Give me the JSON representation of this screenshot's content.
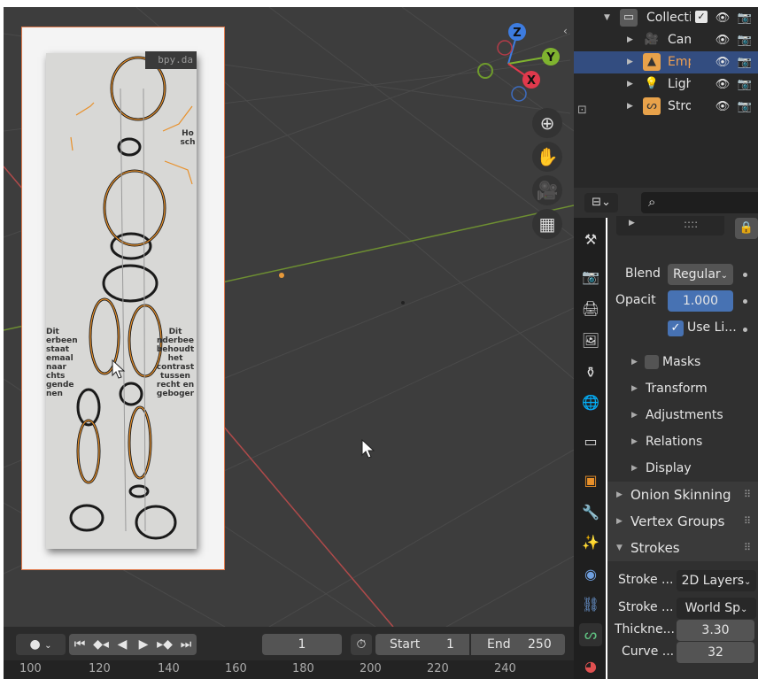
{
  "viewport": {
    "paper_tag": "bpy.da",
    "paper_left_text": [
      "Dit",
      "erbeen",
      "staat",
      "emaal",
      "naar",
      "chts",
      "gende",
      "nen"
    ],
    "paper_right_text": [
      "Dit",
      "nderbee",
      "behoudt",
      "het",
      "contrast",
      "tussen",
      "recht en",
      "geboger"
    ],
    "paper_top_text": [
      "Ho",
      "sch"
    ],
    "gizmo": {
      "z": "Z",
      "y": "Y",
      "x": "X"
    },
    "nav_icons": [
      "zoom-in-icon",
      "hand-pan-icon",
      "camera-icon",
      "grid-ortho-icon"
    ]
  },
  "outliner": {
    "rows": [
      {
        "label": "Collection",
        "icon": "collection-icon",
        "color": "#cccccc"
      },
      {
        "label": "Camera",
        "icon": "camera-icon",
        "color": "#e8a24a"
      },
      {
        "label": "Empty",
        "icon": "image-empty-icon",
        "color": "#e8a24a",
        "selected": true
      },
      {
        "label": "Light",
        "icon": "light-icon",
        "color": "#e8a24a"
      },
      {
        "label": "Stroke",
        "icon": "grease-pencil-icon",
        "color": "#e8a24a"
      }
    ]
  },
  "properties": {
    "search_placeholder": "",
    "layer_list_handle": "::::",
    "blend_label": "Blend",
    "blend_value": "Regular",
    "opacity_label": "Opacit",
    "opacity_value": "1.000",
    "use_lights_label": "Use Li...",
    "use_lights_checked": true,
    "masks_label": "Masks",
    "subpanels": [
      "Transform",
      "Adjustments",
      "Relations",
      "Display"
    ],
    "panels": [
      {
        "label": "Onion Skinning",
        "open": false
      },
      {
        "label": "Vertex Groups",
        "open": false
      },
      {
        "label": "Strokes",
        "open": true
      }
    ],
    "strokes": [
      {
        "label": "Stroke ...",
        "value": "2D Layers",
        "kind": "dropdown"
      },
      {
        "label": "Stroke ...",
        "value": "World Sp",
        "kind": "dropdown"
      },
      {
        "label": "Thickne...",
        "value": "3.30",
        "kind": "number"
      },
      {
        "label": "Curve ...",
        "value": "32",
        "kind": "number"
      }
    ]
  },
  "timeline": {
    "current_frame": "1",
    "start_label": "Start",
    "start_value": "1",
    "end_label": "End",
    "end_value": "250",
    "ruler": [
      "100",
      "120",
      "140",
      "160",
      "180",
      "200",
      "220",
      "240"
    ]
  },
  "colors": {
    "accent_blue": "#4772b3",
    "selection_orange": "#e8a24a",
    "gizmo_x": "#e0394c",
    "gizmo_y": "#7fb32f",
    "gizmo_z": "#3d7ce0"
  }
}
